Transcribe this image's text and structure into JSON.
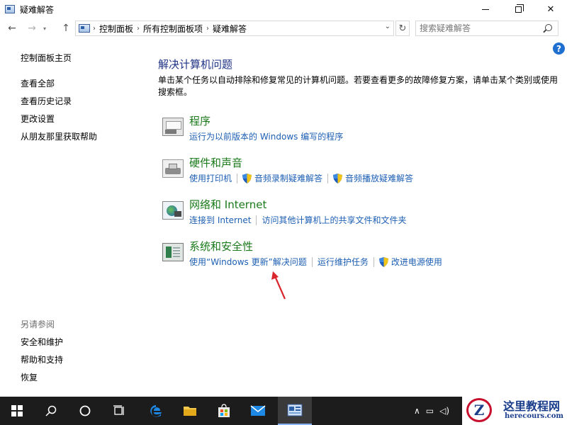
{
  "window": {
    "title": "疑难解答",
    "icon": "control-panel-icon"
  },
  "address": {
    "crumbs": [
      "控制面板",
      "所有控制面板项",
      "疑难解答"
    ],
    "search_placeholder": "搜索疑难解答"
  },
  "sidebar": {
    "home": "控制面板主页",
    "items": [
      "查看全部",
      "查看历史记录",
      "更改设置",
      "从朋友那里获取帮助"
    ],
    "see_also_title": "另请参阅",
    "see_also": [
      "安全和维护",
      "帮助和支持",
      "恢复"
    ]
  },
  "main": {
    "title": "解决计算机问题",
    "description": "单击某个任务以自动排除和修复常见的计算机问题。若要查看更多的故障修复方案，请单击某个类别或使用搜索框。",
    "categories": [
      {
        "title": "程序",
        "icon": "programs-icon",
        "links": [
          {
            "label": "运行为以前版本的 Windows 编写的程序",
            "shield": false
          }
        ]
      },
      {
        "title": "硬件和声音",
        "icon": "hardware-sound-icon",
        "links": [
          {
            "label": "使用打印机",
            "shield": false
          },
          {
            "label": "音频录制疑难解答",
            "shield": true
          },
          {
            "label": "音频播放疑难解答",
            "shield": true
          }
        ]
      },
      {
        "title": "网络和 Internet",
        "icon": "network-internet-icon",
        "links": [
          {
            "label": "连接到 Internet",
            "shield": false
          },
          {
            "label": "访问其他计算机上的共享文件和文件夹",
            "shield": false
          }
        ]
      },
      {
        "title": "系统和安全性",
        "icon": "system-security-icon",
        "links": [
          {
            "label": "使用“Windows 更新”解决问题",
            "shield": false
          },
          {
            "label": "运行维护任务",
            "shield": false
          },
          {
            "label": "改进电源使用",
            "shield": true
          }
        ]
      }
    ]
  },
  "watermark": {
    "badge": "Z",
    "text": "这里教程网",
    "url": "herecours.com"
  },
  "colors": {
    "link": "#1d5fb4",
    "category_title": "#1a7a1a",
    "heading": "#1e3287",
    "taskbar": "#1c1c1c",
    "annotation": "#d9262c"
  }
}
